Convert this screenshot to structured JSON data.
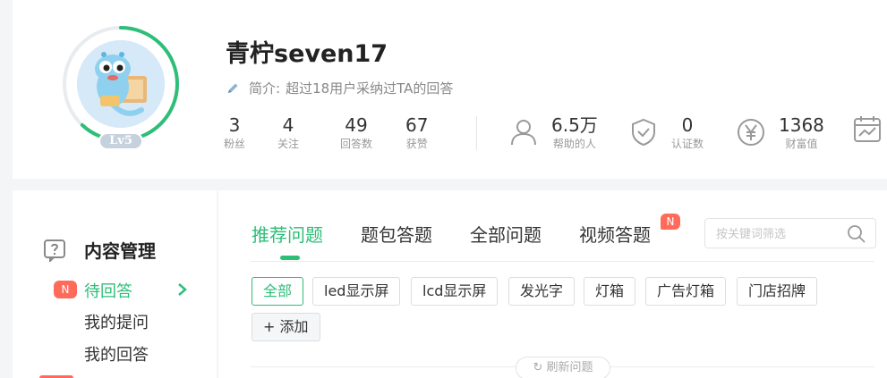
{
  "profile": {
    "username": "青柠seven17",
    "level": "Lv5",
    "intro_label": "简介:",
    "intro_text": "超过18用户采纳过TA的回答",
    "level_progress": 0.62,
    "stats": [
      {
        "value": "3",
        "label": "粉丝"
      },
      {
        "value": "4",
        "label": "关注"
      },
      {
        "value": "49",
        "label": "回答数"
      },
      {
        "value": "67",
        "label": "获赞"
      }
    ],
    "icon_stats": [
      {
        "icon": "user-icon",
        "value": "6.5万",
        "label": "帮助的人"
      },
      {
        "icon": "shield-check-icon",
        "value": "0",
        "label": "认证数"
      },
      {
        "icon": "yen-coin-icon",
        "value": "1368",
        "label": "财富值"
      },
      {
        "icon": "calendar-chart-icon"
      }
    ]
  },
  "sidebar": {
    "title": "内容管理",
    "badge": "N",
    "items": [
      {
        "label": "待回答",
        "active": true
      },
      {
        "label": "我的提问"
      },
      {
        "label": "我的回答"
      }
    ]
  },
  "main": {
    "tabs": [
      {
        "label": "推荐问题",
        "active": true
      },
      {
        "label": "题包答题"
      },
      {
        "label": "全部问题"
      },
      {
        "label": "视频答题"
      }
    ],
    "tab_badge": "N",
    "search_placeholder": "按关键词筛选",
    "chips": [
      "全部",
      "led显示屏",
      "lcd显示屏",
      "发光字",
      "灯箱",
      "广告灯箱",
      "门店招牌"
    ],
    "add_chip": "+ 添加",
    "refresh": "刷新问题"
  },
  "colors": {
    "accent": "#2dbe78",
    "badge": "#ff6b5a",
    "level_badge": "#c6d1de"
  }
}
